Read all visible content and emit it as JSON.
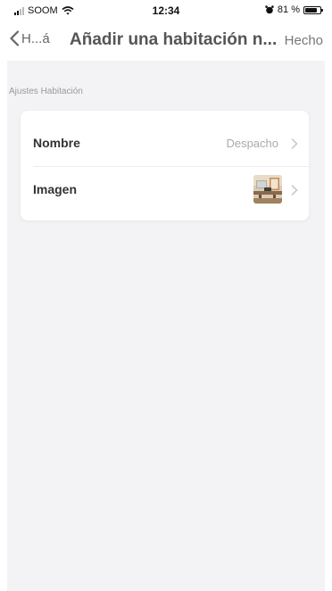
{
  "status_bar": {
    "carrier": "SOOM",
    "time": "12:34",
    "battery_text": "81 %",
    "battery_level": 0.81
  },
  "nav": {
    "back_label": "H...á",
    "title": "Añadir una habitación n...",
    "done_label": "Hecho"
  },
  "section": {
    "header": "Ajustes Habitación"
  },
  "rows": [
    {
      "label": "Nombre",
      "value": "Despacho",
      "icon": "chevron-right-icon"
    },
    {
      "label": "Imagen",
      "value": "",
      "icon": "room-thumbnail-icon"
    }
  ]
}
